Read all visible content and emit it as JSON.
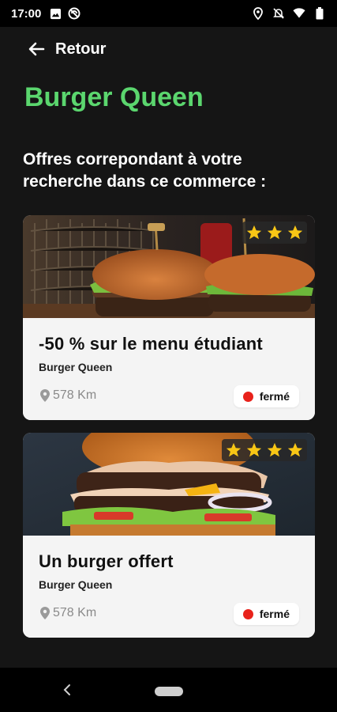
{
  "status_bar": {
    "time": "17:00"
  },
  "header": {
    "back_label": "Retour"
  },
  "shop": {
    "name": "Burger Queen"
  },
  "section": {
    "subtitle": "Offres correpondant à votre recherche dans ce commerce :"
  },
  "colors": {
    "accent": "#5BD66E",
    "closed_dot": "#e8221b",
    "star": "#F8C615"
  },
  "offers": [
    {
      "title": "-50 % sur le menu étudiant",
      "shop": "Burger Queen",
      "distance": "578 Km",
      "status": "fermé",
      "rating": 3
    },
    {
      "title": "Un burger offert",
      "shop": "Burger Queen",
      "distance": "578 Km",
      "status": "fermé",
      "rating": 4
    }
  ],
  "icons": [
    "image-icon",
    "sync-icon",
    "location-icon",
    "notifications-off-icon",
    "wifi-icon",
    "battery-icon",
    "arrow-left-icon",
    "pin-icon",
    "star-icon",
    "nav-back-icon",
    "nav-home-pill"
  ]
}
